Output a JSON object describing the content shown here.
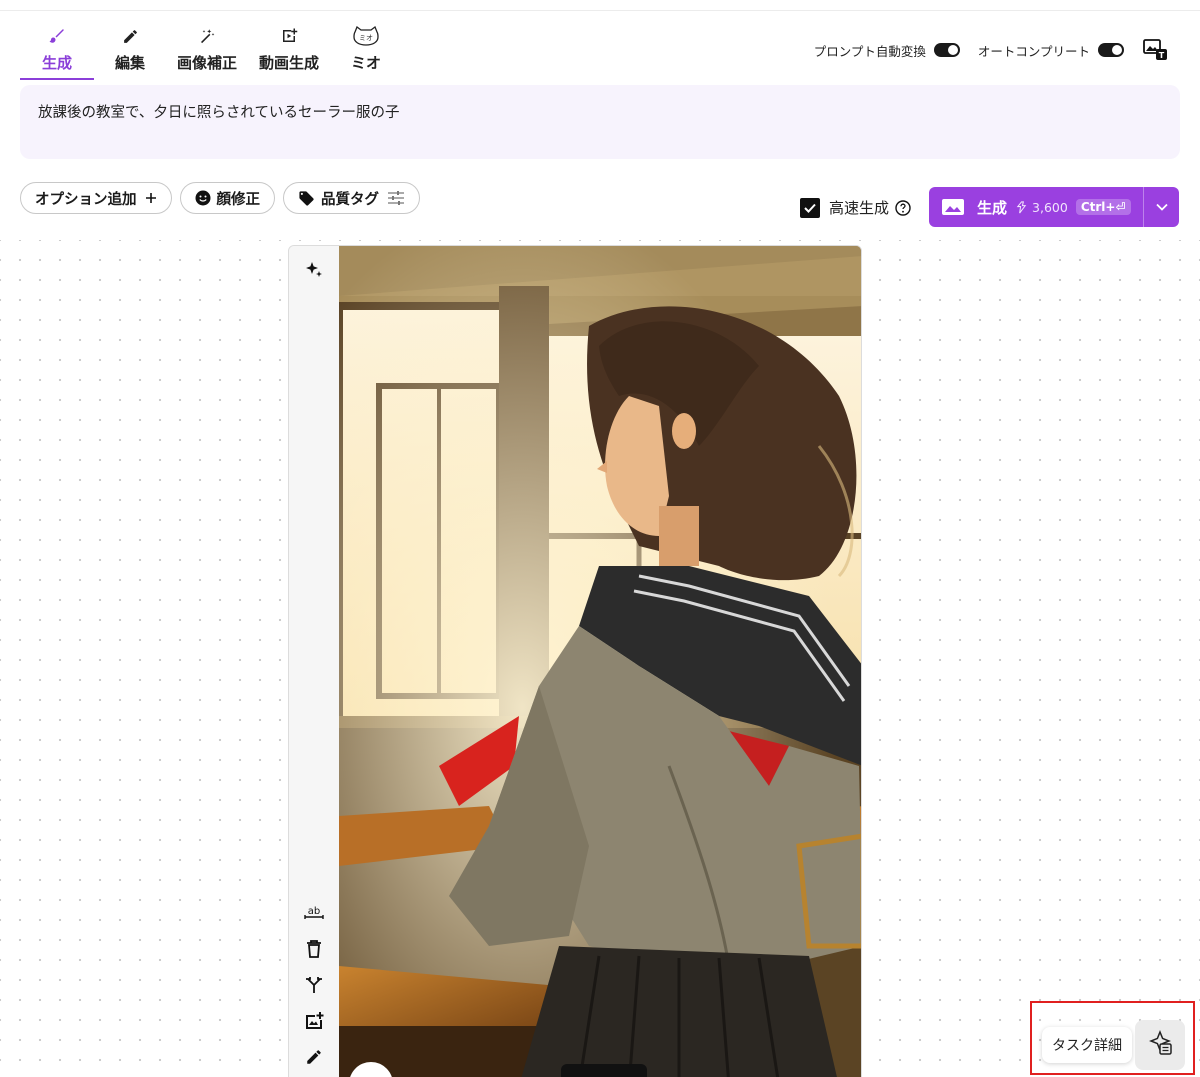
{
  "tabs": [
    {
      "label": "生成",
      "icon": "brush-icon",
      "active": true
    },
    {
      "label": "編集",
      "icon": "pencil-icon",
      "active": false
    },
    {
      "label": "画像補正",
      "icon": "magic-wand-icon",
      "active": false
    },
    {
      "label": "動画生成",
      "icon": "video-add-icon",
      "active": false
    },
    {
      "label": "ミオ",
      "icon": "mio-cat-icon",
      "active": false
    }
  ],
  "header": {
    "prompt_convert_label": "プロンプト自動変換",
    "autocomplete_label": "オートコンプリート",
    "prompt_convert_on": true,
    "autocomplete_on": true,
    "right_icon": "image-translate-icon"
  },
  "prompt": {
    "text": "放課後の教室で、夕日に照らされているセーラー服の子"
  },
  "chips": {
    "add_option": "オプション追加",
    "face_fix": "顔修正",
    "quality_tag": "品質タグ"
  },
  "generate": {
    "fast_label": "高速生成",
    "fast_checked": true,
    "button_label": "生成",
    "cost": "3,600",
    "shortcut": "Ctrl+⏎"
  },
  "side_tools": [
    "sparkle-icon",
    "text-ab-icon",
    "trash-icon",
    "fork-icon",
    "add-image-icon",
    "pencil-icon"
  ],
  "task": {
    "tooltip": "タスク詳細",
    "icon": "task-sparkle-icon"
  },
  "colors": {
    "accent": "#9a40e0",
    "prompt_bg": "#f7f3fd",
    "highlight": "#e0201f"
  }
}
